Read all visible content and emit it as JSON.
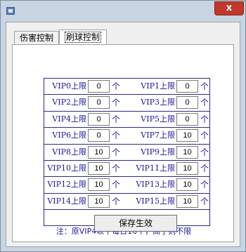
{
  "window": {
    "close_label": "x"
  },
  "tabs": [
    {
      "label": "伤害控制",
      "active": false
    },
    {
      "label": "刷球控制",
      "active": true
    }
  ],
  "limits": [
    {
      "label": "VIP0上限",
      "value": "0",
      "unit": "个"
    },
    {
      "label": "VIP1上限",
      "value": "0",
      "unit": "个"
    },
    {
      "label": "VIP2上限",
      "value": "0",
      "unit": "个"
    },
    {
      "label": "VIP3上限",
      "value": "0",
      "unit": "个"
    },
    {
      "label": "VIP4上限",
      "value": "0",
      "unit": "个"
    },
    {
      "label": "VIP5上限",
      "value": "0",
      "unit": "个"
    },
    {
      "label": "VIP6上限",
      "value": "0",
      "unit": "个"
    },
    {
      "label": "VIP7上限",
      "value": "10",
      "unit": "个"
    },
    {
      "label": "VIP8上限",
      "value": "10",
      "unit": "个"
    },
    {
      "label": "VIP9上限",
      "value": "10",
      "unit": "个"
    },
    {
      "label": "VIP10上限",
      "value": "10",
      "unit": "个"
    },
    {
      "label": "VIP11上限",
      "value": "10",
      "unit": "个"
    },
    {
      "label": "VIP12上限",
      "value": "10",
      "unit": "个"
    },
    {
      "label": "VIP13上限",
      "value": "10",
      "unit": "个"
    },
    {
      "label": "VIP14上限",
      "value": "10",
      "unit": "个"
    },
    {
      "label": "VIP15上限",
      "value": "10",
      "unit": "个"
    }
  ],
  "note": "注：原VIP4以下每日10个，高于则不限",
  "save_label": "保存生效"
}
